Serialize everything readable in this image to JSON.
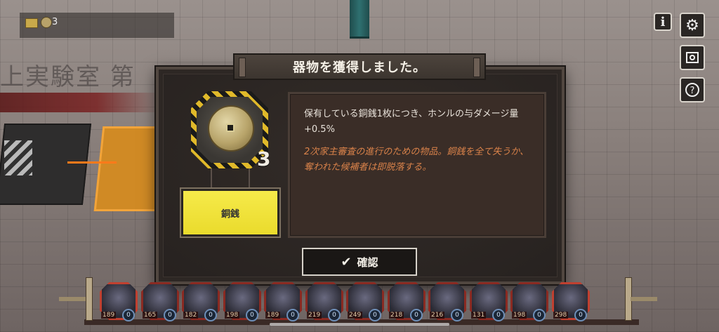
{
  "background": {
    "floor_sign": "上実験室 第"
  },
  "hud": {
    "item_count": "3",
    "icons": [
      "ticket-icon",
      "coin-icon"
    ]
  },
  "side_buttons": {
    "info_label": "i",
    "icons": [
      "info-icon",
      "gear-icon",
      "book-icon",
      "help-icon"
    ]
  },
  "modal": {
    "title": "器物を獲得しました。",
    "item": {
      "name": "銅銭",
      "count": "3",
      "icon": "coin-icon"
    },
    "description": {
      "effect": "保有している銅銭1枚につき、ホンルの与ダメージ量 +0.5%",
      "lore": "2次家主審査の進行のための物品。銅銭を全て失うか、奪われた候補者は即脱落する。"
    },
    "confirm_label": "確認"
  },
  "party": [
    {
      "hp": "189",
      "level": "0"
    },
    {
      "hp": "165",
      "level": "0"
    },
    {
      "hp": "182",
      "level": "0"
    },
    {
      "hp": "198",
      "level": "0"
    },
    {
      "hp": "189",
      "level": "0"
    },
    {
      "hp": "219",
      "level": "0"
    },
    {
      "hp": "249",
      "level": "0"
    },
    {
      "hp": "218",
      "level": "0"
    },
    {
      "hp": "216",
      "level": "0"
    },
    {
      "hp": "131",
      "level": "0"
    },
    {
      "hp": "198",
      "level": "0"
    },
    {
      "hp": "298",
      "level": "0"
    }
  ],
  "colors": {
    "accent_yellow": "#f6ea4a",
    "lore_orange": "#d9824a",
    "frame_red": "#8a2a22"
  }
}
